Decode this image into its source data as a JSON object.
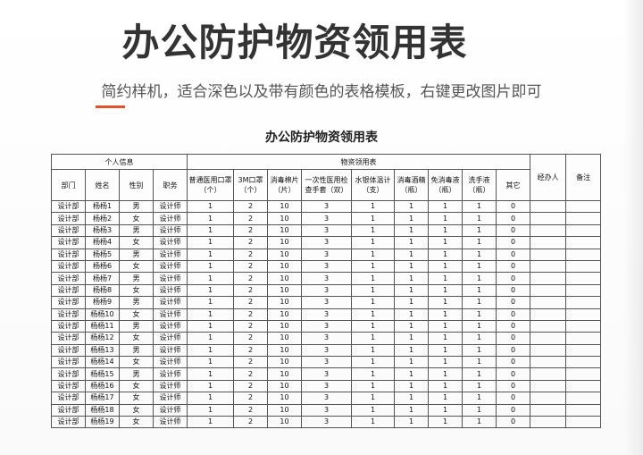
{
  "header": {
    "title": "办公防护物资领用表",
    "subtitle": "简约样机，适合深色以及带有颜色的表格模板，右键更改图片即可",
    "accent_color": "#e0502a"
  },
  "sheet": {
    "title": "办公防护物资领用表",
    "group_personal": "个人信息",
    "group_supplies": "物资领用表",
    "handler": "经办人",
    "remarks": "备注",
    "columns": [
      "部门",
      "姓名",
      "性别",
      "职务",
      "普通医用口罩（个）",
      "3M口罩（个）",
      "消毒棉片（片）",
      "一次性医用检查手套（双）",
      "水银体温计（支）",
      "消毒酒精（瓶）",
      "免消毒液（瓶）",
      "洗手液（瓶）",
      "其它"
    ],
    "rows": [
      [
        "设计部",
        "杨杨1",
        "男",
        "设计师",
        "1",
        "2",
        "10",
        "3",
        "1",
        "1",
        "1",
        "1",
        "0"
      ],
      [
        "设计部",
        "杨杨2",
        "女",
        "设计师",
        "1",
        "2",
        "10",
        "3",
        "1",
        "1",
        "1",
        "1",
        "0"
      ],
      [
        "设计部",
        "杨杨3",
        "男",
        "设计师",
        "1",
        "2",
        "10",
        "3",
        "1",
        "1",
        "1",
        "1",
        "0"
      ],
      [
        "设计部",
        "杨杨4",
        "女",
        "设计师",
        "1",
        "2",
        "10",
        "3",
        "1",
        "1",
        "1",
        "1",
        "0"
      ],
      [
        "设计部",
        "杨杨5",
        "男",
        "设计师",
        "1",
        "2",
        "10",
        "3",
        "1",
        "1",
        "1",
        "1",
        "0"
      ],
      [
        "设计部",
        "杨杨6",
        "女",
        "设计师",
        "1",
        "2",
        "10",
        "3",
        "1",
        "1",
        "1",
        "1",
        "0"
      ],
      [
        "设计部",
        "杨杨7",
        "男",
        "设计师",
        "1",
        "2",
        "10",
        "3",
        "1",
        "1",
        "1",
        "1",
        "0"
      ],
      [
        "设计部",
        "杨杨8",
        "女",
        "设计师",
        "1",
        "2",
        "10",
        "3",
        "1",
        "1",
        "1",
        "1",
        "0"
      ],
      [
        "设计部",
        "杨杨9",
        "男",
        "设计师",
        "1",
        "2",
        "10",
        "3",
        "1",
        "1",
        "1",
        "1",
        "0"
      ],
      [
        "设计部",
        "杨杨10",
        "女",
        "设计师",
        "1",
        "2",
        "10",
        "3",
        "1",
        "1",
        "1",
        "1",
        "0"
      ],
      [
        "设计部",
        "杨杨11",
        "男",
        "设计师",
        "1",
        "2",
        "10",
        "3",
        "1",
        "1",
        "1",
        "1",
        "0"
      ],
      [
        "设计部",
        "杨杨12",
        "女",
        "设计师",
        "1",
        "2",
        "10",
        "3",
        "1",
        "1",
        "1",
        "1",
        "0"
      ],
      [
        "设计部",
        "杨杨13",
        "男",
        "设计师",
        "1",
        "2",
        "10",
        "3",
        "1",
        "1",
        "1",
        "1",
        "0"
      ],
      [
        "设计部",
        "杨杨14",
        "女",
        "设计师",
        "1",
        "2",
        "10",
        "3",
        "1",
        "1",
        "1",
        "1",
        "0"
      ],
      [
        "设计部",
        "杨杨15",
        "男",
        "设计师",
        "1",
        "2",
        "10",
        "3",
        "1",
        "1",
        "1",
        "1",
        "0"
      ],
      [
        "设计部",
        "杨杨16",
        "女",
        "设计师",
        "1",
        "2",
        "10",
        "3",
        "1",
        "1",
        "1",
        "1",
        "0"
      ],
      [
        "设计部",
        "杨杨17",
        "女",
        "设计师",
        "1",
        "2",
        "10",
        "3",
        "1",
        "1",
        "1",
        "1",
        "0"
      ],
      [
        "设计部",
        "杨杨18",
        "女",
        "设计师",
        "1",
        "2",
        "10",
        "3",
        "1",
        "1",
        "1",
        "1",
        "0"
      ],
      [
        "设计部",
        "杨杨19",
        "女",
        "设计师",
        "1",
        "2",
        "10",
        "3",
        "1",
        "1",
        "1",
        "1",
        "0"
      ]
    ]
  }
}
